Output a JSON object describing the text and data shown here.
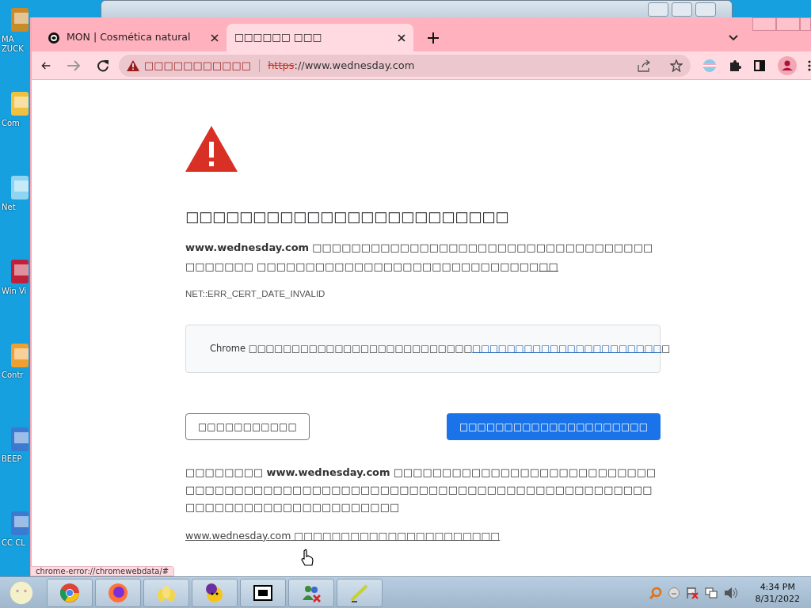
{
  "desktop_icons": [
    {
      "label": "MA ZUCK"
    },
    {
      "label": "Com"
    },
    {
      "label": "Net"
    },
    {
      "label": "Win Vi"
    },
    {
      "label": "Contr"
    },
    {
      "label": "BEEP"
    },
    {
      "label": "CC CL"
    }
  ],
  "browser": {
    "tabs": [
      {
        "title": "MON | Cosmética natural",
        "selected": false
      },
      {
        "title": "□□□□□□ □□□",
        "selected": true
      }
    ],
    "address": {
      "security_label": "□□□□□□□□□□□",
      "scheme": "https",
      "rest": "://www.wednesday.com"
    },
    "forward_disabled": true
  },
  "page": {
    "heading": "□□□□□□□□□□□□□□□□□□□□□□□□",
    "intro": "**www.wednesday.com** □□□□□□□□□□□□□□□□□□□□□□□□□□□□□□□□□□□□□□□□□□ □□□□□□□□□□□□□□□□□□□□□□□□□□□□□",
    "intro_link": "□□",
    "error_code": "NET::ERR_CERT_DATE_INVALID",
    "tip": "Chrome □□□□□□□□□□□□□□□□□□□□□□□□□□",
    "tip_link": "□□□□□□□□□□□□□□□□□□□□□□",
    "tip_end": "□",
    "buttons": [
      {
        "label": "□□□□□□□□□□□",
        "kind": "outline"
      },
      {
        "label": "□□□□□□□□□□□□□□□□□□□□□",
        "kind": "primary"
      }
    ],
    "details": "□□□□□□□□ **www.wednesday.com** □□□□□□□□□□□□□□□□□□□□□□□□□□□□□□□□□□□□□□□□□□□□□□□□□□□□□□□□□□□□□□□□□□□□□□□□□□□□□□□□□□□□□□□□□□□□□□□□□",
    "proceed_link": "www.wednesday.com □□□□□□□□□□□□□□□□□□□□□□"
  },
  "status_url": "chrome-error://chromewebdata/#",
  "taskbar": {
    "items": [
      {
        "kind": "chrome"
      },
      {
        "kind": "firefox"
      },
      {
        "kind": "eggs"
      },
      {
        "kind": "messenger"
      },
      {
        "kind": "archiver"
      },
      {
        "kind": "people"
      },
      {
        "kind": "pen"
      }
    ],
    "time": "4:34 PM",
    "date": "8/31/2022"
  }
}
